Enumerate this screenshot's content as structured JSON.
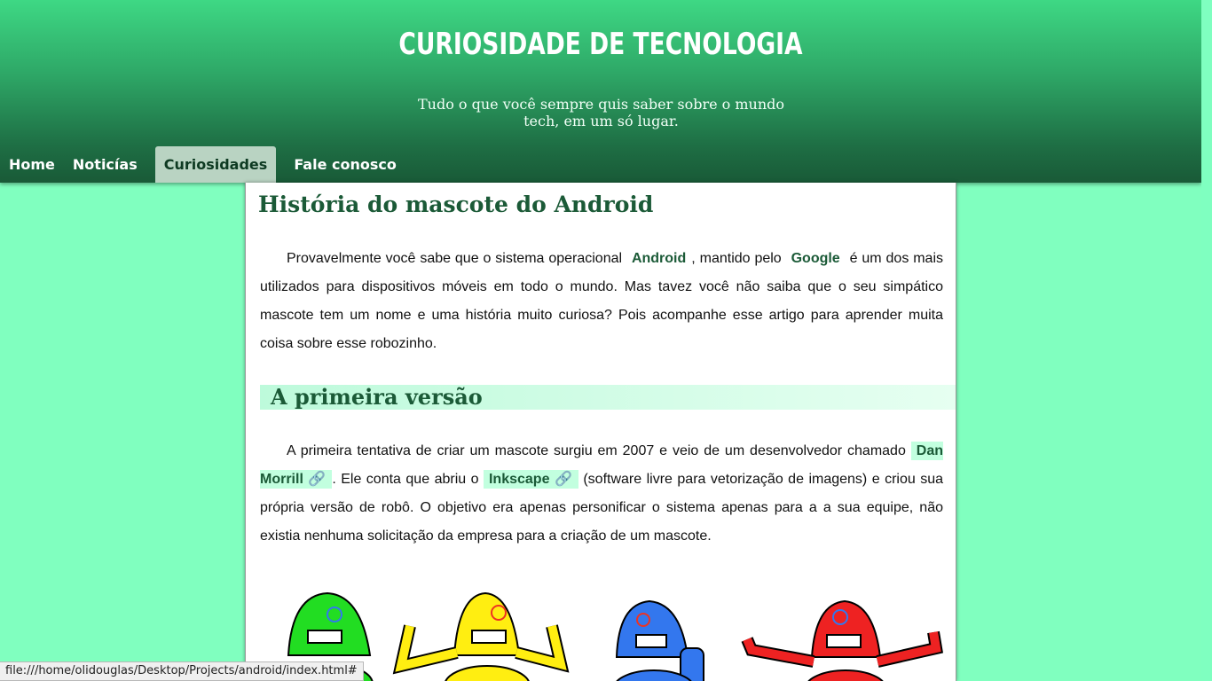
{
  "header": {
    "title": "CURIOSIDADE DE TECNOLOGIA",
    "subtitle": "Tudo o que você sempre quis saber sobre o mundo tech, em um só lugar."
  },
  "nav": {
    "items": [
      {
        "label": "Home"
      },
      {
        "label": "Noticías"
      },
      {
        "label": "Curiosidades"
      },
      {
        "label": "Fale conosco"
      }
    ],
    "active": "Curiosidades"
  },
  "article": {
    "title": "História do mascote do Android",
    "p1": {
      "t1": "Provavelmente você sabe que o sistema operacional ",
      "k1": "Android",
      "t2": ", mantido pelo ",
      "k2": "Google",
      "t3": " é um dos mais utilizados para dispositivos móveis em todo o mundo. Mas tavez você não saiba que o seu simpático mascote tem um nome e uma história muito curiosa? Pois acompanhe esse artigo para aprender muita coisa sobre esse robozinho."
    },
    "section1": {
      "heading": "A primeira versão",
      "t1": "A primeira tentativa de criar um mascote surgiu em 2007 e veio de um desenvolvedor chamado ",
      "link1": "Dan Morrill",
      "t2": ". Ele conta que abriu o ",
      "link2": "Inkscape",
      "t3": " (software livre para vetorização de imagens) e criou sua própria versão de robô. O objetivo era apenas personificar o sistema apenas para a a sua equipe, não existia nenhuma solicitação da empresa para a criação de um mascote."
    },
    "robot_colors": [
      "#22dd22",
      "#ffee11",
      "#3377ee",
      "#ee2222"
    ]
  },
  "status_bar": {
    "url": "file:///home/olidouglas/Desktop/Projects/android/index.html#"
  },
  "icons": {
    "link": "link-icon"
  }
}
